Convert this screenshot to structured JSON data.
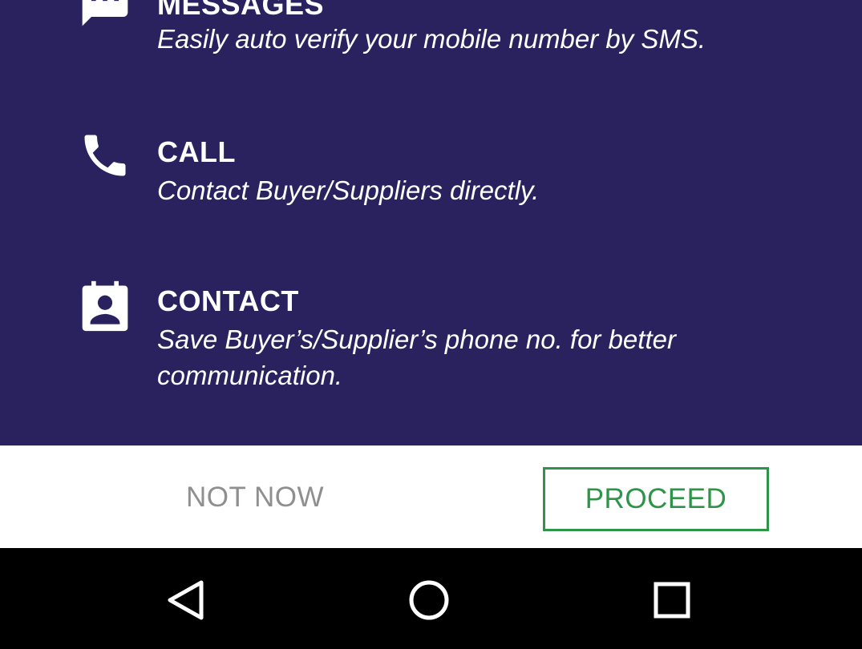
{
  "colors": {
    "panel_background": "#29225f",
    "text": "#ffffff",
    "proceed_accent": "#2e9447",
    "not_now_text": "#8f8f8f",
    "nav_background": "#000000"
  },
  "permissions": [
    {
      "icon": "message-icon",
      "title": "MESSAGES",
      "description": "Easily auto verify your mobile number by SMS."
    },
    {
      "icon": "phone-icon",
      "title": "CALL",
      "description": "Contact Buyer/Suppliers directly."
    },
    {
      "icon": "contact-icon",
      "title": "CONTACT",
      "description": "Save Buyer’s/Supplier’s phone no. for better communication."
    }
  ],
  "actions": {
    "not_now_label": "NOT NOW",
    "proceed_label": "PROCEED"
  },
  "navbar": {
    "back": "back-triangle-icon",
    "home": "home-circle-icon",
    "recents": "recents-square-icon"
  }
}
